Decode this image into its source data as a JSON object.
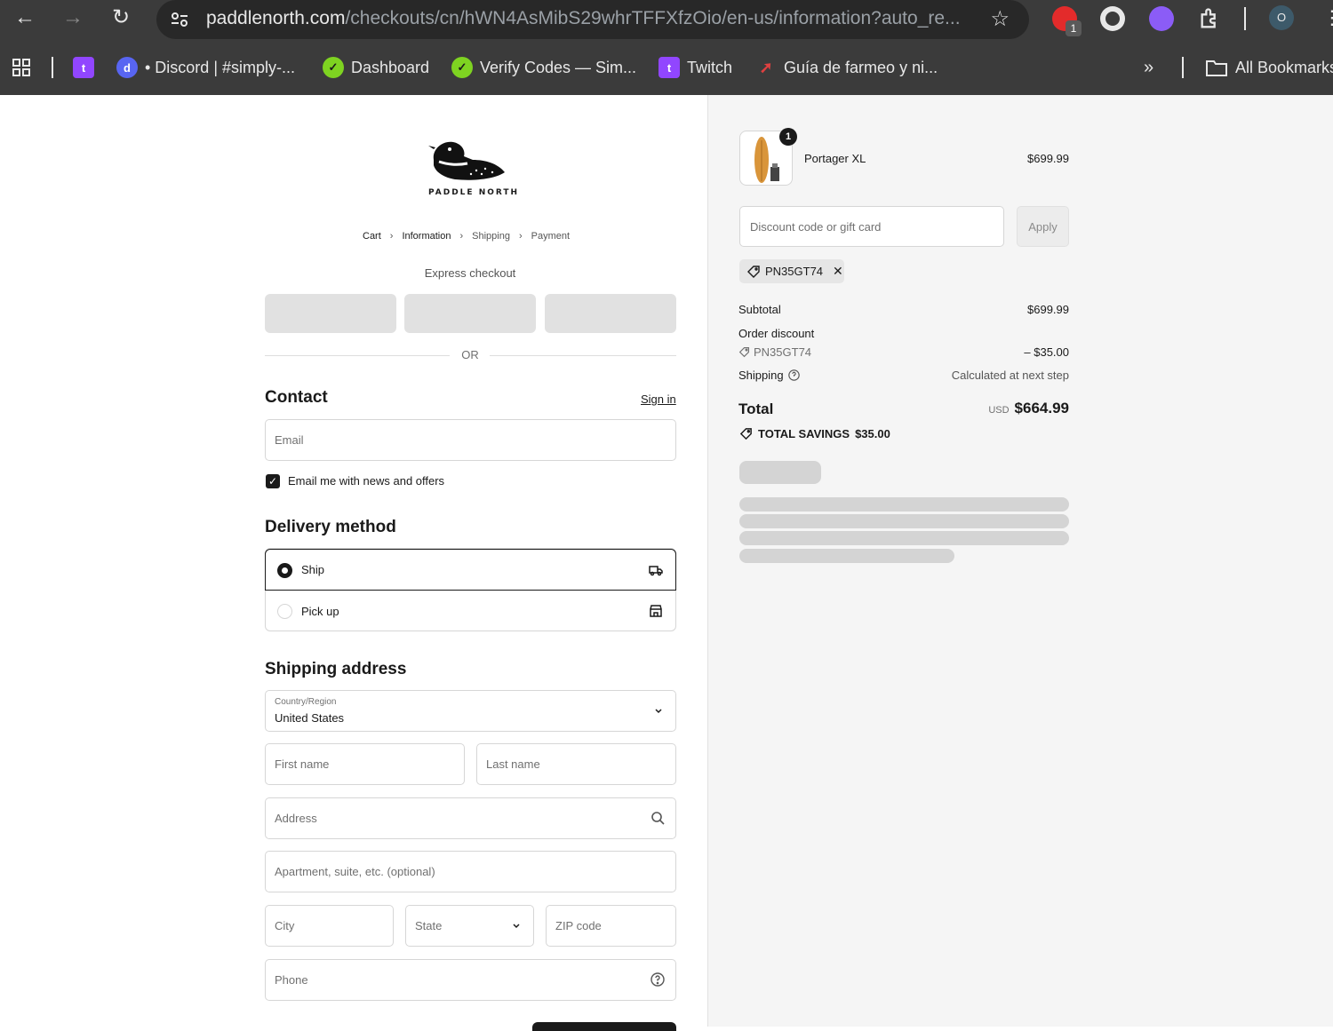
{
  "browser": {
    "url_host": "paddlenorth.com",
    "url_path": "/checkouts/cn/hWN4AsMibS29whrTFFXfzOio/en-us/information?auto_re...",
    "extension_badge": "1",
    "profile_initial": "O",
    "bookmarks": [
      {
        "label": "• Discord | #simply-...",
        "icon": "discord-icon"
      },
      {
        "label": "Dashboard",
        "icon": "check-leaf-icon"
      },
      {
        "label": "Verify Codes — Sim...",
        "icon": "check-leaf-icon"
      },
      {
        "label": "Twitch",
        "icon": "twitch-icon"
      },
      {
        "label": "Guía de farmeo y ni...",
        "icon": "feather-icon"
      }
    ],
    "all_bookmarks": "All Bookmarks"
  },
  "checkout": {
    "brand": "PADDLE NORTH",
    "breadcrumbs": [
      "Cart",
      "Information",
      "Shipping",
      "Payment"
    ],
    "express_label": "Express checkout",
    "or_label": "OR",
    "contact_heading": "Contact",
    "sign_in": "Sign in",
    "email_placeholder": "Email",
    "newsletter_label": "Email me with news and offers",
    "newsletter_checked": true,
    "delivery_heading": "Delivery method",
    "delivery_options": [
      {
        "label": "Ship",
        "selected": true
      },
      {
        "label": "Pick up",
        "selected": false
      }
    ],
    "shipping_heading": "Shipping address",
    "country_label": "Country/Region",
    "country_value": "United States",
    "first_name_placeholder": "First name",
    "last_name_placeholder": "Last name",
    "address_placeholder": "Address",
    "apartment_placeholder": "Apartment, suite, etc. (optional)",
    "city_placeholder": "City",
    "state_placeholder": "State",
    "zip_placeholder": "ZIP code",
    "phone_placeholder": "Phone"
  },
  "summary": {
    "item_name": "Portager XL",
    "item_price": "$699.99",
    "item_qty": "1",
    "discount_placeholder": "Discount code or gift card",
    "apply_label": "Apply",
    "applied_code": "PN35GT74",
    "subtotal_label": "Subtotal",
    "subtotal_value": "$699.99",
    "order_discount_label": "Order discount",
    "order_discount_code": "PN35GT74",
    "order_discount_value": "– $35.00",
    "shipping_label": "Shipping",
    "shipping_value": "Calculated at next step",
    "total_label": "Total",
    "currency": "USD",
    "total_value": "$664.99",
    "savings_label": "TOTAL SAVINGS",
    "savings_value": "$35.00"
  }
}
